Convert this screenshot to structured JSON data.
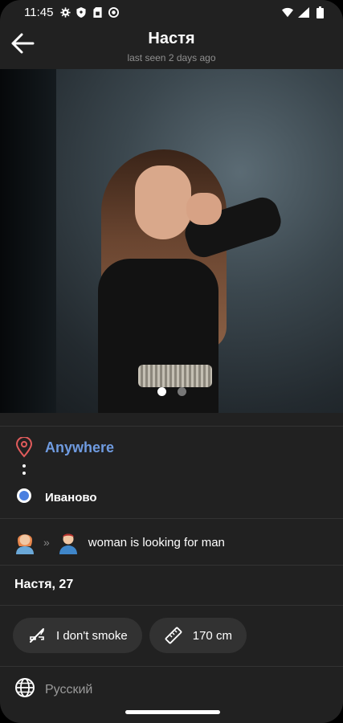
{
  "status_bar": {
    "time": "11:45",
    "left_icons": [
      "gear-icon",
      "shield-icon",
      "sim-card-icon",
      "vpn-icon"
    ],
    "right_icons": [
      "wifi-icon",
      "signal-icon",
      "battery-icon"
    ]
  },
  "header": {
    "title": "Настя",
    "subtitle": "last seen 2 days ago",
    "back_icon": "arrow-left-icon"
  },
  "photo": {
    "page_count": 2,
    "current_page": 1
  },
  "location": {
    "from_label": "Anywhere",
    "to_label": "Иваново",
    "accent_color": "#6f9be0",
    "pin_color": "#e05b5b",
    "dot_color": "#4a7fe0"
  },
  "looking_for": {
    "text": "woman is looking for man",
    "separator": "»"
  },
  "profile": {
    "name_age": "Настя, 27"
  },
  "chips": [
    {
      "icon": "no-smoking-icon",
      "label": "I don't smoke"
    },
    {
      "icon": "ruler-icon",
      "label": "170 cm"
    }
  ],
  "language": {
    "icon": "globe-icon",
    "label": "Русский"
  }
}
